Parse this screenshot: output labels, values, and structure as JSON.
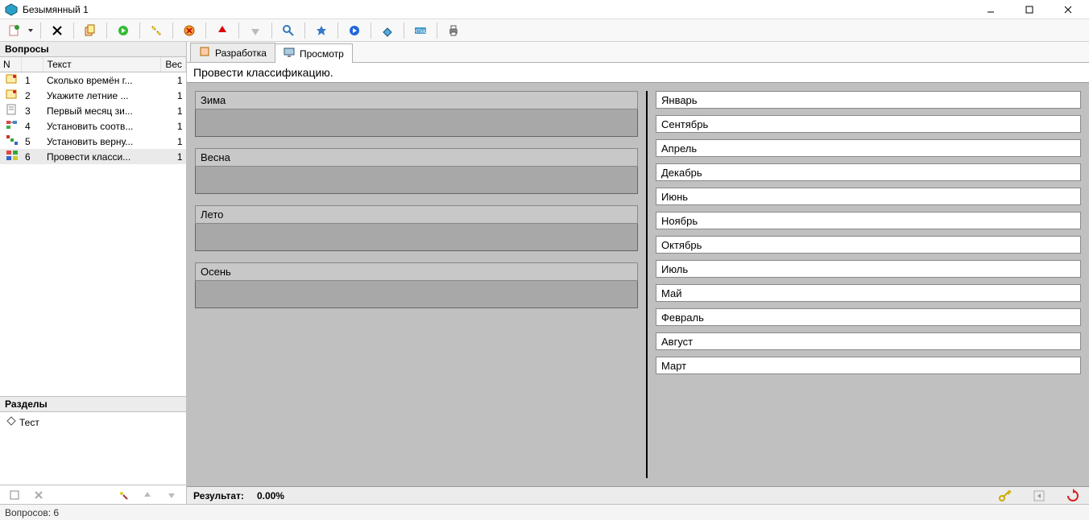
{
  "window": {
    "title": "Безымянный 1"
  },
  "sidebar": {
    "questions_header": "Вопросы",
    "col_n": "N",
    "col_text": "Текст",
    "col_weight": "Вес",
    "questions": [
      {
        "n": "1",
        "text": "Сколько времён г...",
        "weight": "1",
        "icon": "qtype-single"
      },
      {
        "n": "2",
        "text": "Укажите летние ...",
        "weight": "1",
        "icon": "qtype-single"
      },
      {
        "n": "3",
        "text": "Первый месяц зи...",
        "weight": "1",
        "icon": "qtype-text"
      },
      {
        "n": "4",
        "text": "Установить соотв...",
        "weight": "1",
        "icon": "qtype-match"
      },
      {
        "n": "5",
        "text": "Установить верну...",
        "weight": "1",
        "icon": "qtype-order"
      },
      {
        "n": "6",
        "text": "Провести класси...",
        "weight": "1",
        "icon": "qtype-classify",
        "selected": true
      }
    ],
    "sections_header": "Разделы",
    "tree_root": "Тест"
  },
  "tabs": {
    "design": "Разработка",
    "preview": "Просмотр"
  },
  "question": {
    "instruction": "Провести классификацию.",
    "categories": [
      "Зима",
      "Весна",
      "Лето",
      "Осень"
    ],
    "items": [
      "Январь",
      "Сентябрь",
      "Апрель",
      "Декабрь",
      "Июнь",
      "Ноябрь",
      "Октябрь",
      "Июль",
      "Май",
      "Февраль",
      "Август",
      "Март"
    ]
  },
  "result": {
    "label": "Результат:",
    "value": "0.00%"
  },
  "status": {
    "question_count": "Вопросов: 6"
  }
}
